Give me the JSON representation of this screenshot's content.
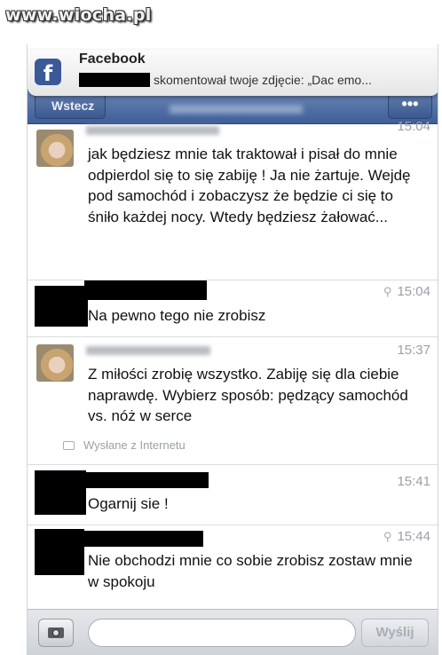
{
  "watermark": "www.wiocha.pl",
  "notification": {
    "app": "Facebook",
    "text": "skomentował twoje zdjęcie: „Dac emo..."
  },
  "nav": {
    "back_label": "Wstecz",
    "more_label": "•••"
  },
  "messages": [
    {
      "time": "15:04",
      "text": "jak będziesz mnie tak traktował i pisał do mnie odpierdol się to się zabiję ! Ja nie żartuje. Wejdę pod samochód i zobaczysz że będzie ci się to śniło każdej nocy. Wtedy będziesz żałować..."
    },
    {
      "time": "15:04",
      "text": "Na pewno tego nie zrobisz"
    },
    {
      "time": "15:37",
      "text": "Z miłości zrobię wszystko. Zabiję się dla ciebie naprawdę. Wybierz sposób: pędzący samochód vs. nóż w serce",
      "footer": "Wysłane z Internetu"
    },
    {
      "time": "15:41",
      "text": "Ogarnij sie !"
    },
    {
      "time": "15:44",
      "text": "Nie obchodzi mnie co sobie zrobisz zostaw mnie w spokoju"
    }
  ],
  "composer": {
    "placeholder": "",
    "send_label": "Wyślij"
  },
  "colors": {
    "facebook_blue": "#3b5998",
    "timestamp_gray": "#9aa0a8"
  }
}
